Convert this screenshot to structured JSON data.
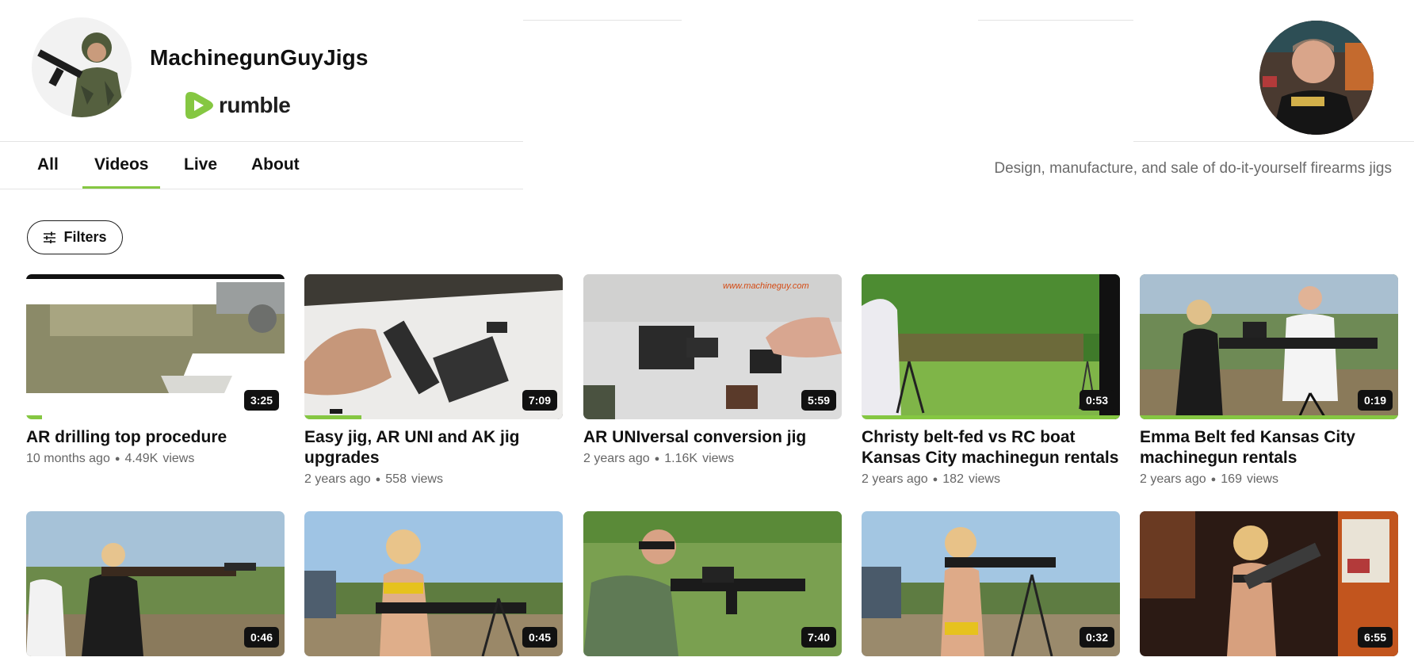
{
  "channel": {
    "name": "MachinegunGuyJigs",
    "platform": "rumble",
    "tagline": "Design, manufacture, and sale of do-it-yourself firearms jigs"
  },
  "tabs": [
    {
      "label": "All",
      "active": false
    },
    {
      "label": "Videos",
      "active": true
    },
    {
      "label": "Live",
      "active": false
    },
    {
      "label": "About",
      "active": false
    }
  ],
  "filters": {
    "label": "Filters"
  },
  "colors": {
    "accent": "#85c742",
    "text": "#111111",
    "muted": "#666666"
  },
  "videos": [
    {
      "title_lines": [
        "AR drilling top procedure"
      ],
      "age": "10 months ago",
      "views": "4.49K",
      "views_label": "views",
      "duration": "3:25",
      "watched": 0.06
    },
    {
      "title_lines": [
        "Easy jig, AR UNI and AK jig",
        "upgrades"
      ],
      "age": "2 years ago",
      "views": "558",
      "views_label": "views",
      "duration": "7:09",
      "watched": 0.22
    },
    {
      "title_lines": [
        "AR UNIversal conversion jig"
      ],
      "age": "2 years ago",
      "views": "1.16K",
      "views_label": "views",
      "duration": "5:59",
      "watched": 0,
      "watermark": "www.machineguy.com"
    },
    {
      "title_lines": [
        "Christy belt-fed vs RC boat",
        "Kansas City machinegun rentals"
      ],
      "age": "2 years ago",
      "views": "182",
      "views_label": "views",
      "duration": "0:53",
      "watched": 1.0
    },
    {
      "title_lines": [
        "Emma Belt fed Kansas City",
        "machinegun rentals"
      ],
      "age": "2 years ago",
      "views": "169",
      "views_label": "views",
      "duration": "0:19",
      "watched": 1.0
    },
    {
      "duration": "0:46"
    },
    {
      "duration": "0:45"
    },
    {
      "duration": "7:40"
    },
    {
      "duration": "0:32"
    },
    {
      "duration": "6:55"
    }
  ]
}
